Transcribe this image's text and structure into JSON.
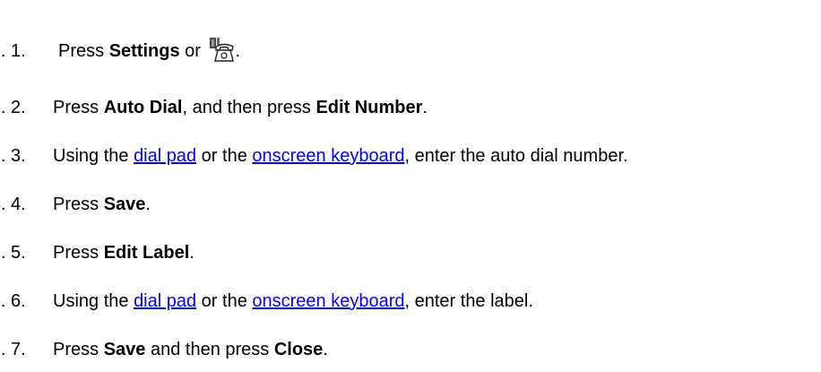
{
  "steps": [
    {
      "number": "1.",
      "text_press": "Press ",
      "bold_settings": "Settings",
      "text_or": " or ",
      "icon": "phone-settings-icon",
      "text_end": "."
    },
    {
      "number": "2.",
      "text_press": "Press ",
      "bold_auto_dial": "Auto Dial",
      "text_mid": ", and then press ",
      "bold_edit_number": "Edit Number",
      "text_end": "."
    },
    {
      "number": "3.",
      "text_using": "Using the ",
      "link_dial_pad": "dial pad",
      "text_or": " or the ",
      "link_keyboard": "onscreen keyboard",
      "text_end": ", enter the auto dial number."
    },
    {
      "number": "4.",
      "text_press": "Press ",
      "bold_save": "Save",
      "text_end": "."
    },
    {
      "number": "5.",
      "text_press": "Press ",
      "bold_edit_label": "Edit Label",
      "text_end": "."
    },
    {
      "number": "6.",
      "text_using": "Using the ",
      "link_dial_pad": "dial pad",
      "text_or": " or the ",
      "link_keyboard": "onscreen keyboard",
      "text_end": ", enter the label."
    },
    {
      "number": "7.",
      "text_press": "Press ",
      "bold_save": "Save",
      "text_mid": " and then press ",
      "bold_close": "Close",
      "text_end": "."
    }
  ],
  "colors": {
    "text": "#000000",
    "link": "#0000ff"
  }
}
